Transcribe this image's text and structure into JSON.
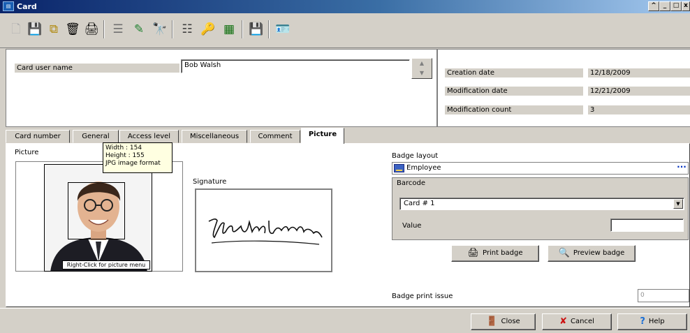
{
  "window": {
    "title": "Card",
    "icon": "card-app-icon",
    "controls": [
      "restore",
      "minimize",
      "maximize",
      "close"
    ]
  },
  "toolbar": {
    "buttons": [
      {
        "name": "new-icon",
        "glyph": "🗋"
      },
      {
        "name": "save-icon",
        "glyph": "💾"
      },
      {
        "name": "copy-icon",
        "glyph": "⧉"
      },
      {
        "name": "delete-icon",
        "glyph": "🗑"
      },
      {
        "name": "print-icon",
        "glyph": "🖨"
      },
      {
        "name": "list-icon",
        "glyph": "☰"
      },
      {
        "name": "link-icon",
        "glyph": "✎"
      },
      {
        "name": "find-icon",
        "glyph": "🔭"
      },
      {
        "name": "details-icon",
        "glyph": "☷"
      },
      {
        "name": "key-icon",
        "glyph": "🔑"
      },
      {
        "name": "grid-icon",
        "glyph": "▦"
      },
      {
        "name": "floppy-icon",
        "glyph": "💾"
      },
      {
        "name": "badge-print-icon",
        "glyph": "🪪"
      }
    ]
  },
  "header": {
    "card_user_name_label": "Card user name",
    "card_user_name_value": "Bob Walsh",
    "creation_date_label": "Creation date",
    "creation_date_value": "12/18/2009",
    "modification_date_label": "Modification date",
    "modification_date_value": "12/21/2009",
    "modification_count_label": "Modification count",
    "modification_count_value": "3"
  },
  "tabs": [
    {
      "label": "Card number",
      "active": false
    },
    {
      "label": "General",
      "active": false
    },
    {
      "label": "Access level",
      "active": false
    },
    {
      "label": "Miscellaneous",
      "active": false
    },
    {
      "label": "Comment",
      "active": false
    },
    {
      "label": "Picture",
      "active": true
    }
  ],
  "picture_tab": {
    "picture_label": "Picture",
    "tooltip": {
      "width": "Width : 154",
      "height": "Height : 155",
      "format": "JPG image format"
    },
    "right_click_hint": "Right-Click for picture menu",
    "signature_label": "Signature",
    "badge_layout_label": "Badge layout",
    "badge_layout_value": "Employee",
    "barcode_group_label": "Barcode",
    "barcode_selected": "Card # 1",
    "value_label": "Value",
    "value_field": "",
    "print_badge_label": "Print badge",
    "preview_badge_label": "Preview badge",
    "badge_print_issue_label": "Badge print issue",
    "badge_print_issue_value": "0"
  },
  "footer": {
    "close_label": "Close",
    "cancel_label": "Cancel",
    "help_label": "Help"
  },
  "colors": {
    "title_gradient_start": "#0a246a",
    "title_gradient_end": "#a6caf0",
    "face": "#d4d0c8",
    "cancel_red": "#cc1010",
    "help_blue": "#1a6fd6"
  }
}
